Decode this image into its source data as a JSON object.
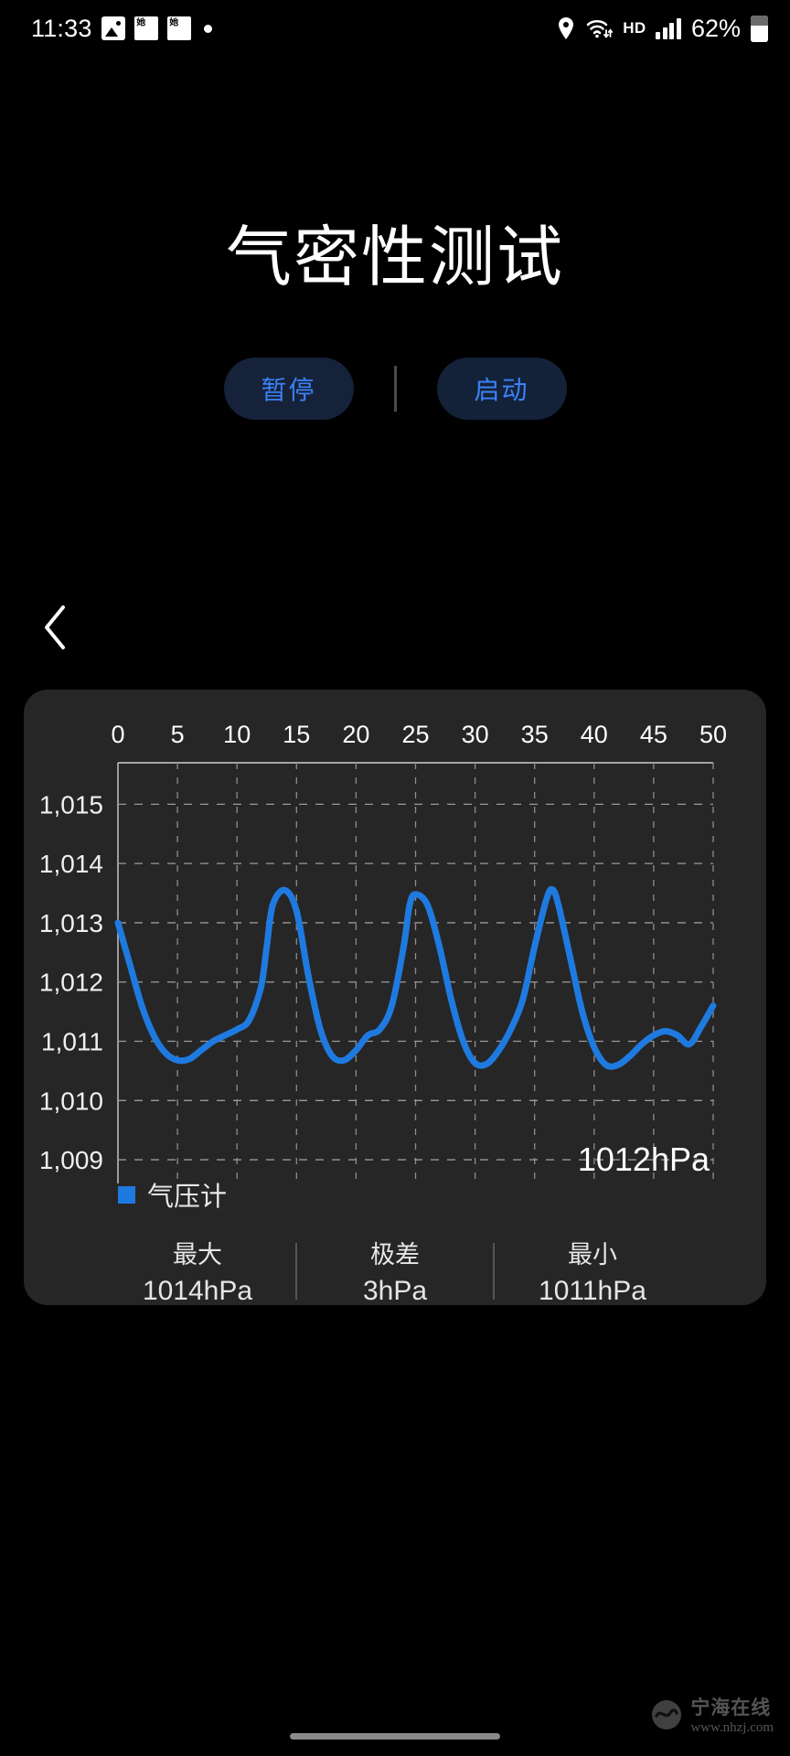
{
  "status_bar": {
    "time": "11:33",
    "icons_left": [
      "photo-icon",
      "app-icon-1",
      "app-icon-2",
      "dot-indicator"
    ],
    "app_icon_1_text": "她",
    "app_icon_2_text": "她",
    "icons_right": [
      "location-pin-icon",
      "wifi-icon",
      "hd-icon",
      "signal-icon"
    ],
    "hd_label": "HD",
    "battery_percent": "62%"
  },
  "header": {
    "title": "气密性测试"
  },
  "controls": {
    "pause_label": "暂停",
    "start_label": "启动"
  },
  "navigation": {
    "back_label": "返回"
  },
  "chart_card": {
    "value_annotation": "1012hPa",
    "legend": [
      {
        "label": "气压计",
        "color": "#1f7ae0"
      }
    ],
    "stats": [
      {
        "label": "最大",
        "value": "1014hPa"
      },
      {
        "label": "极差",
        "value": "3hPa"
      },
      {
        "label": "最小",
        "value": "1011hPa"
      }
    ]
  },
  "watermark": {
    "name": "宁海在线",
    "url": "www.nhzj.com"
  },
  "colors": {
    "accent": "#1f7ae0",
    "button_text": "#3b82f6",
    "button_bg": "#16223a",
    "card_bg": "#262626",
    "page_bg": "#000000"
  },
  "chart_data": {
    "type": "line",
    "title": "",
    "xlabel": "",
    "ylabel": "",
    "xlim": [
      0,
      50
    ],
    "ylim": [
      1008.6,
      1015.7
    ],
    "xticks": [
      0,
      5,
      10,
      15,
      20,
      25,
      30,
      35,
      40,
      45,
      50
    ],
    "xticklabels": [
      "0",
      "5",
      "10",
      "15",
      "20",
      "25",
      "30",
      "35",
      "40",
      "45",
      "50"
    ],
    "yticks": [
      1015,
      1014,
      1013,
      1012,
      1011,
      1010,
      1009
    ],
    "yticklabels": [
      "1,015",
      "1,014",
      "1,013",
      "1,012",
      "1,011",
      "1,010",
      "1,009"
    ],
    "grid": true,
    "grid_style": "dashed",
    "x_axis_position": "top",
    "legend_position": "bottom-left",
    "annotation": "1012hPa",
    "series": [
      {
        "name": "气压计",
        "color": "#1f7ae0",
        "unit": "hPa",
        "x": [
          0,
          1,
          2,
          3,
          4,
          5,
          6,
          7,
          8,
          9,
          10,
          11,
          12,
          12.5,
          13,
          14,
          15,
          16,
          17,
          18,
          19,
          20,
          21,
          22,
          23,
          24,
          24.5,
          25,
          26,
          27,
          28,
          29,
          30,
          31,
          32,
          33,
          34,
          35,
          36,
          36.5,
          37,
          38,
          39,
          40,
          41,
          42,
          43,
          44,
          45,
          46,
          47,
          48,
          49,
          50
        ],
        "y": [
          1013.0,
          1012.3,
          1011.6,
          1011.1,
          1010.8,
          1010.68,
          1010.7,
          1010.85,
          1011.0,
          1011.1,
          1011.2,
          1011.35,
          1011.9,
          1012.6,
          1013.3,
          1013.55,
          1013.2,
          1012.1,
          1011.2,
          1010.75,
          1010.68,
          1010.85,
          1011.1,
          1011.2,
          1011.6,
          1012.6,
          1013.3,
          1013.48,
          1013.3,
          1012.6,
          1011.7,
          1011.0,
          1010.63,
          1010.62,
          1010.85,
          1011.2,
          1011.7,
          1012.6,
          1013.4,
          1013.56,
          1013.3,
          1012.4,
          1011.5,
          1010.9,
          1010.6,
          1010.6,
          1010.75,
          1010.95,
          1011.1,
          1011.17,
          1011.1,
          1010.95,
          1011.25,
          1011.6
        ]
      }
    ]
  }
}
